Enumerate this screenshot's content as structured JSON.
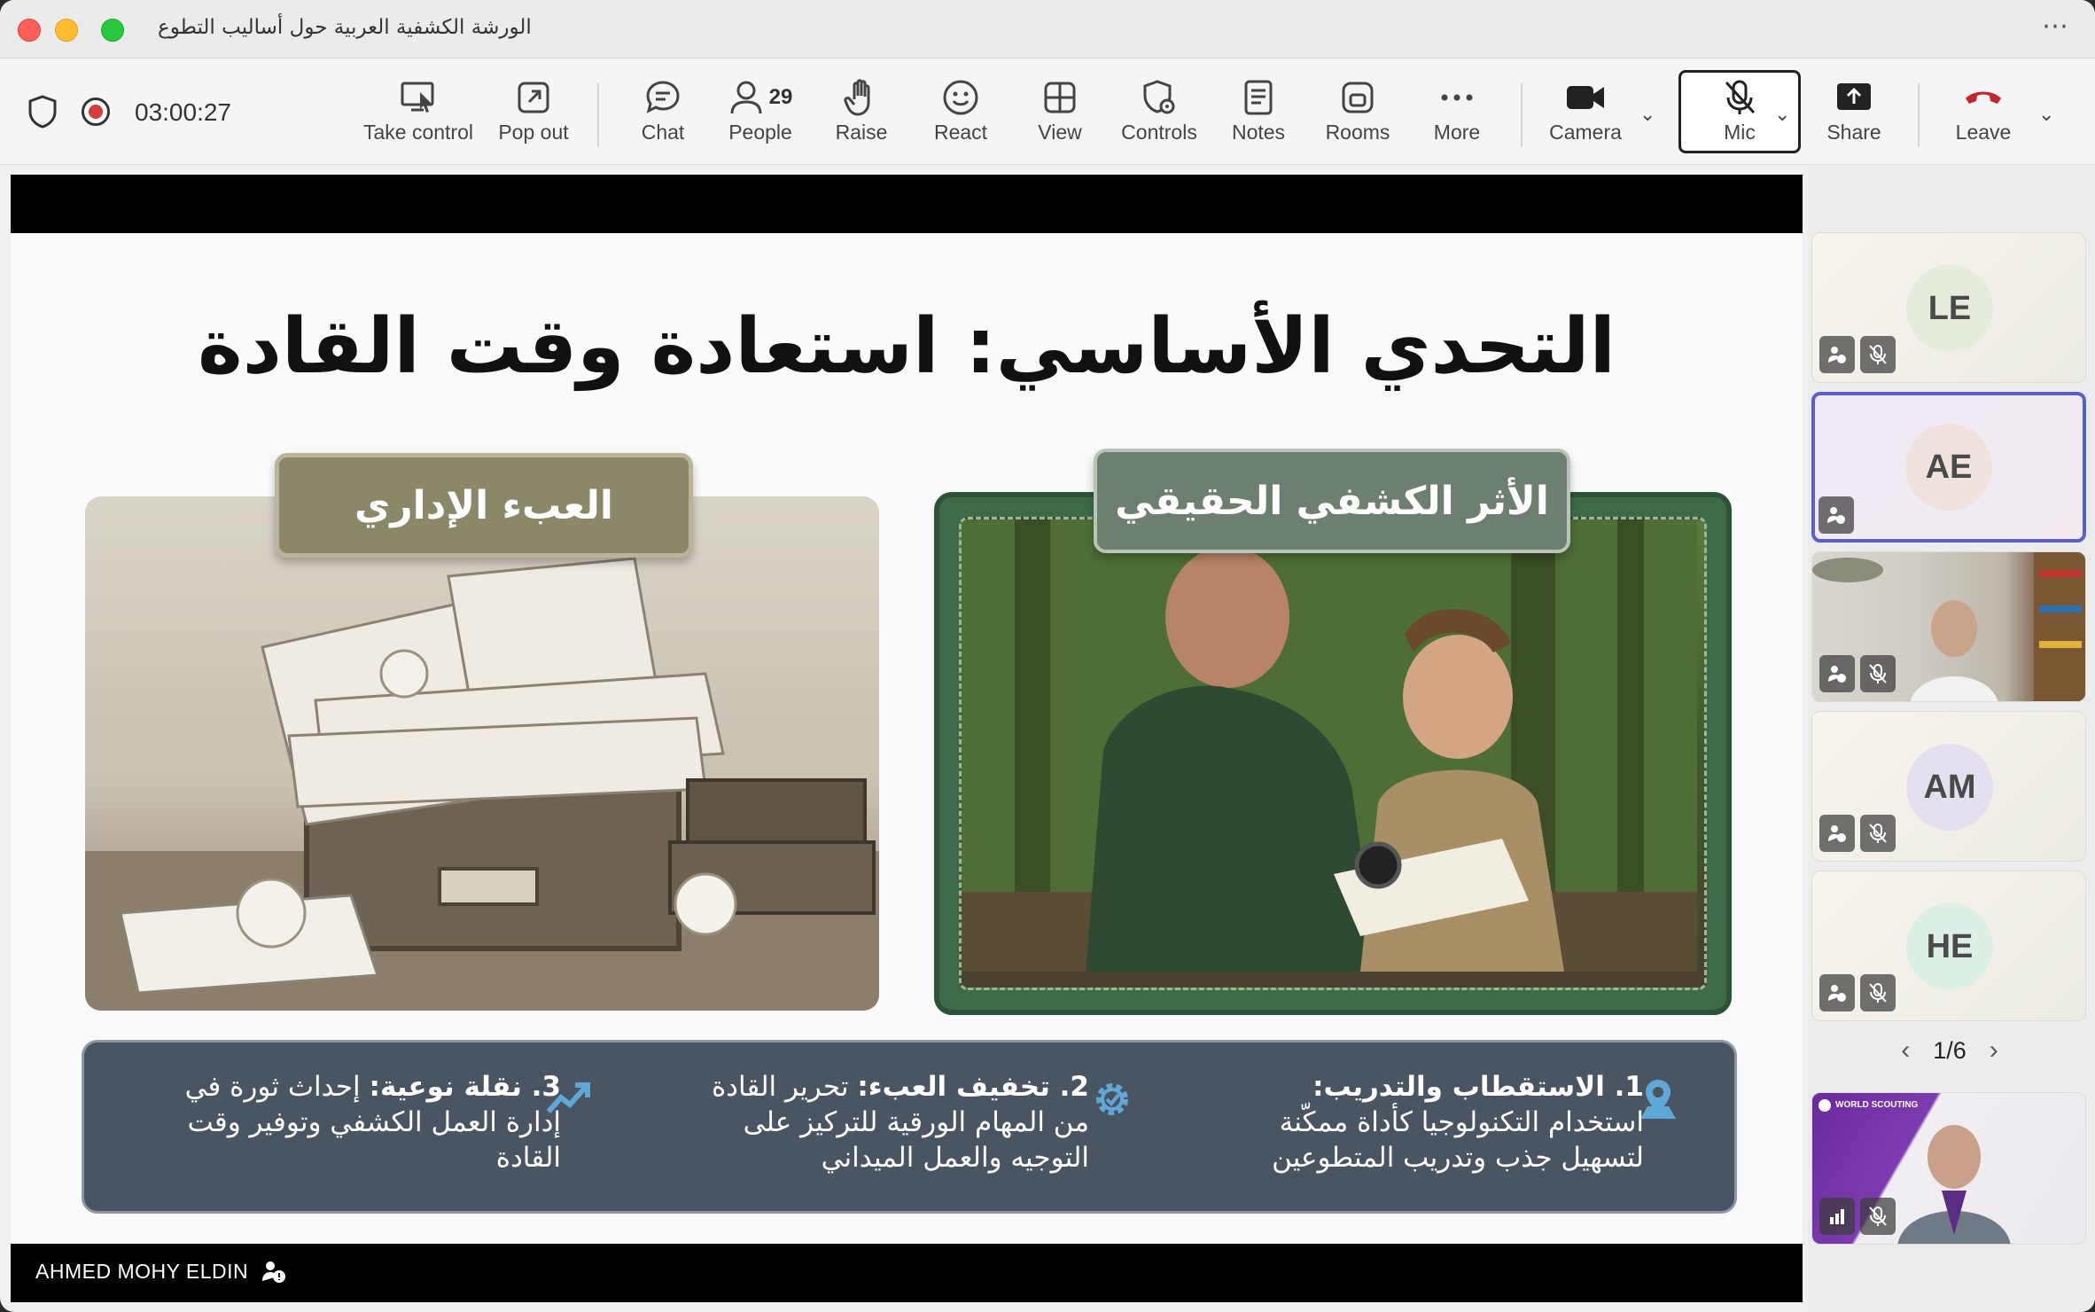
{
  "window": {
    "title": "الورشة الكشفية العربية حول أساليب التطوع"
  },
  "toolbar": {
    "timer": "03:00:27",
    "take_control": "Take control",
    "pop_out": "Pop out",
    "chat": "Chat",
    "people_count": "29",
    "people": "People",
    "raise": "Raise",
    "react": "React",
    "view": "View",
    "controls": "Controls",
    "notes": "Notes",
    "rooms": "Rooms",
    "more": "More",
    "camera": "Camera",
    "mic": "Mic",
    "share": "Share",
    "leave": "Leave"
  },
  "slide": {
    "title": "التحدي الأساسي: استعادة وقت القادة",
    "left_tag": "العبء الإداري",
    "right_tag": "الأثر الكشفي الحقيقي",
    "points": [
      {
        "lead": "1. الاستقطاب والتدريب:",
        "text": "استخدام التكنولوجيا كأداة ممكّنة لتسهيل جذب وتدريب المتطوعين"
      },
      {
        "lead": "2. تخفيف العبء:",
        "text": "تحرير القادة من المهام الورقية للتركيز على التوجيه والعمل الميداني"
      },
      {
        "lead": "3. نقلة نوعية:",
        "text": "إحداث ثورة في إدارة العمل الكشفي وتوفير وقت القادة"
      }
    ]
  },
  "presenter": {
    "name": "AHMED MOHY ELDIN"
  },
  "participants": [
    {
      "initials": "LE",
      "color": "#e6ecdc"
    },
    {
      "initials": "AE",
      "color": "#f0e2dc"
    },
    {
      "initials": "",
      "video": true
    },
    {
      "initials": "AM",
      "color": "#e4e0f0"
    },
    {
      "initials": "HE",
      "color": "#dcefe4"
    }
  ],
  "pager": {
    "label": "1/6"
  },
  "self_view": {
    "logo_text": "WORLD SCOUTING"
  }
}
